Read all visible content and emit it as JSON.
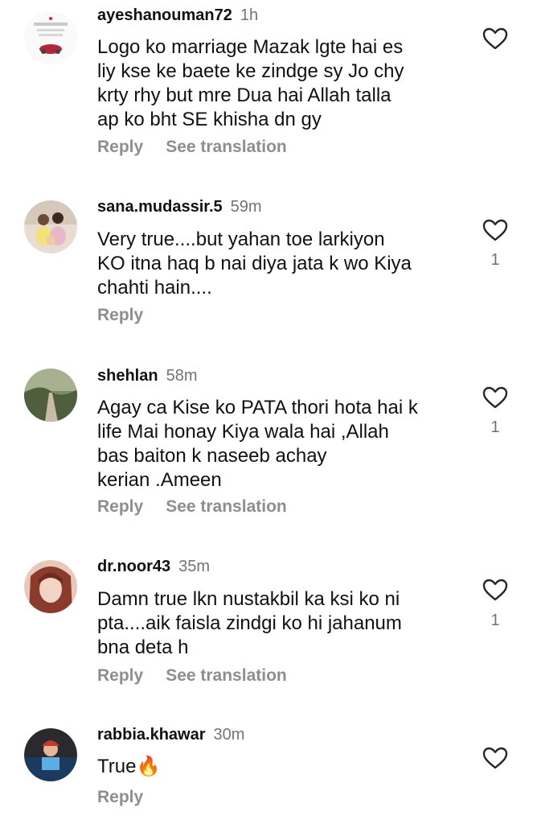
{
  "comments": [
    {
      "username": "ayeshanouman72",
      "time": "1h",
      "text": "Logo ko marriage Mazak lgte hai es\nliy kse ke baete ke zindge sy Jo chy\nkrty rhy but mre Dua hai Allah talla\nap ko bht SE khisha dn gy",
      "reply": "Reply",
      "translate": "See translation",
      "likes": ""
    },
    {
      "username": "sana.mudassir.5",
      "time": "59m",
      "text": "Very true....but yahan toe larkiyon\nKO itna haq b nai diya  jata  k wo Kiya\nchahti hain....",
      "reply": "Reply",
      "translate": "",
      "likes": "1"
    },
    {
      "username": "shehlan",
      "time": "58m",
      "text": "Agay ca Kise ko PATA thori hota hai k\nlife Mai honay Kiya wala hai ,Allah\nbas baiton k naseeb achay\nkerian .Ameen",
      "reply": "Reply",
      "translate": "See translation",
      "likes": "1"
    },
    {
      "username": "dr.noor43",
      "time": "35m",
      "text": "Damn true lkn nustakbil ka ksi ko ni\npta....aik faisla zindgi ko hi jahanum\nbna deta h",
      "reply": "Reply",
      "translate": "See translation",
      "likes": "1"
    },
    {
      "username": "rabbia.khawar",
      "time": "30m",
      "text": "True🔥",
      "reply": "Reply",
      "translate": "",
      "likes": ""
    }
  ],
  "icons": {
    "like": "heart-icon"
  },
  "colors": {
    "username": "#111111",
    "muted": "#8e8e8e",
    "fire": "#ff6a00"
  }
}
